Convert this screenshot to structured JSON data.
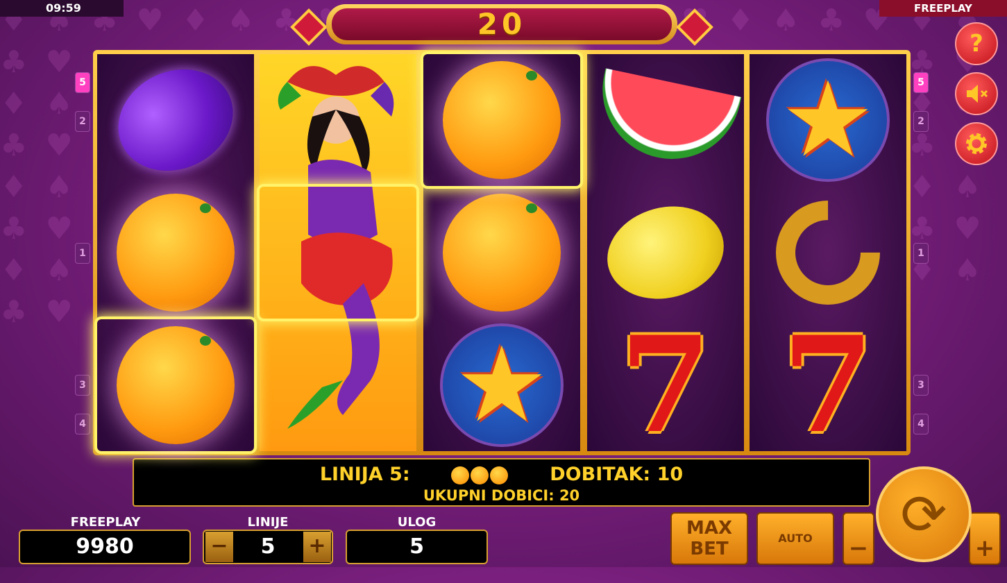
{
  "clock": "09:59",
  "mode_banner": "FREEPLAY",
  "win_display": "20",
  "line_numbers_left": [
    "5",
    "2",
    "1",
    "3",
    "4"
  ],
  "line_numbers_right": [
    "5",
    "2",
    "1",
    "3",
    "4"
  ],
  "reels": [
    [
      "plum",
      "orange",
      "orange"
    ],
    [
      "wild",
      "wild",
      "wild"
    ],
    [
      "orange",
      "orange",
      "star"
    ],
    [
      "watermelon",
      "lemon",
      "seven"
    ],
    [
      "star",
      "horseshoe",
      "seven"
    ]
  ],
  "side_buttons": {
    "help": "?",
    "sound": "speaker-muted-icon",
    "settings": "gear-icon"
  },
  "info": {
    "line_label": "LINIJA 5:",
    "win_label": "DOBITAK: 10",
    "total_label": "UKUPNI DOBICI: 20"
  },
  "balance": {
    "label": "FREEPLAY",
    "value": "9980"
  },
  "lines": {
    "label": "LINIJE",
    "value": "5",
    "minus": "−",
    "plus": "+"
  },
  "bet": {
    "label": "ULOG",
    "value": "5"
  },
  "buttons": {
    "max_bet_line1": "MAX",
    "max_bet_line2": "BET",
    "auto": "AUTO",
    "minus": "−",
    "plus": "+"
  },
  "colors": {
    "accent": "#ffc627",
    "highlight": "#fff36a",
    "background": "#7a1f7e"
  }
}
